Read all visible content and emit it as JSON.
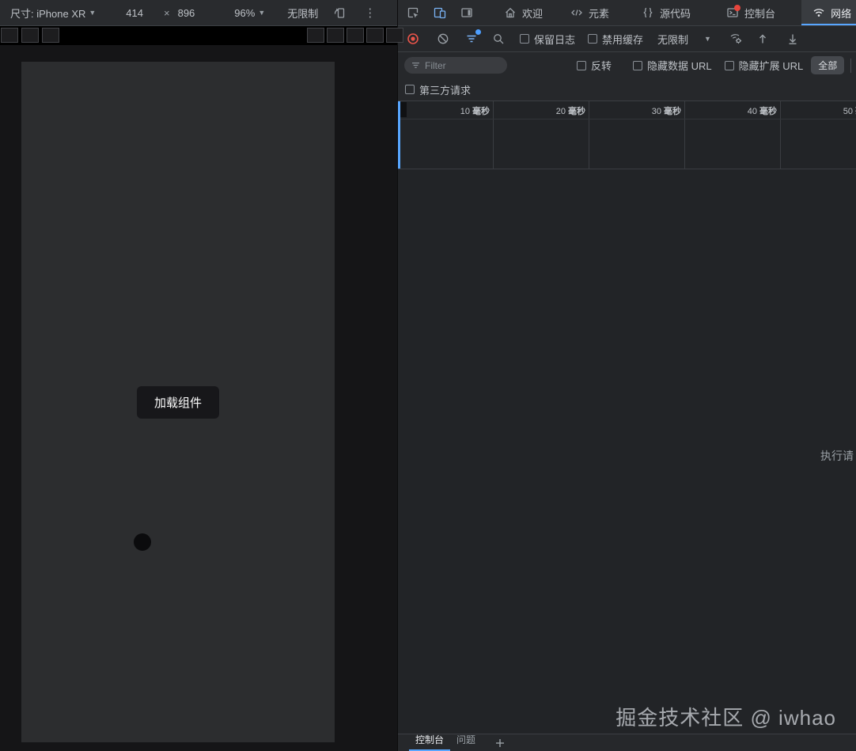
{
  "device_toolbar": {
    "dimensions": "尺寸: iPhone XR",
    "width": "414",
    "multiply": "×",
    "height": "896",
    "zoom": "96%",
    "throttling": "无限制"
  },
  "phone": {
    "toast": "加载组件"
  },
  "devtools": {
    "tabs": {
      "welcome": "欢迎",
      "elements": "元素",
      "sources": "源代码",
      "console": "控制台",
      "network": "网络"
    },
    "network_toolbar": {
      "preserve_log": "保留日志",
      "disable_cache": "禁用缓存",
      "throttling": "无限制"
    },
    "filter_bar": {
      "placeholder": "Filter",
      "invert": "反转",
      "hide_data_urls": "隐藏数据 URL",
      "hide_extension_urls": "隐藏扩展 URL",
      "all": "全部"
    },
    "third_party": "第三方请求",
    "timeline": {
      "ticks": [
        {
          "value": "10",
          "unit": "毫秒"
        },
        {
          "value": "20",
          "unit": "毫秒"
        },
        {
          "value": "30",
          "unit": "毫秒"
        },
        {
          "value": "40",
          "unit": "毫秒"
        },
        {
          "value": "50",
          "unit": "毫秒"
        }
      ]
    },
    "empty_message": "执行请",
    "watermark": "掘金技术社区 @ iwhao",
    "drawer": {
      "console": "控制台",
      "issues": "问题"
    }
  },
  "colors": {
    "accent_blue": "#58a6ff",
    "record_red": "#e8544a",
    "badge_red": "#e8453c"
  }
}
